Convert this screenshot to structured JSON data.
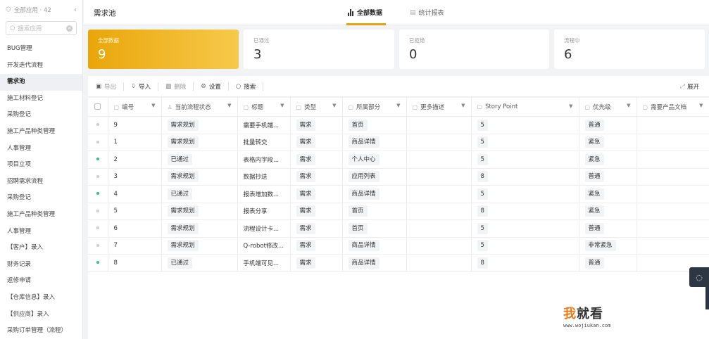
{
  "sidebar": {
    "header_label": "全部应用 · 42",
    "search_placeholder": "搜索应用",
    "items": [
      {
        "label": "BUG管理",
        "active": false
      },
      {
        "label": "开发迭代流程",
        "active": false
      },
      {
        "label": "需求池",
        "active": true
      },
      {
        "label": "施工材料登记",
        "active": false
      },
      {
        "label": "采购登记",
        "active": false
      },
      {
        "label": "施工产品种类管理",
        "active": false
      },
      {
        "label": "人事管理",
        "active": false
      },
      {
        "label": "项目立项",
        "active": false
      },
      {
        "label": "招聘需求流程",
        "active": false
      },
      {
        "label": "采购登记",
        "active": false
      },
      {
        "label": "施工产品种类管理",
        "active": false
      },
      {
        "label": "人事管理",
        "active": false
      },
      {
        "label": "【客户】录入",
        "active": false
      },
      {
        "label": "财务记录",
        "active": false
      },
      {
        "label": "返修申请",
        "active": false
      },
      {
        "label": "【仓库信息】录入",
        "active": false
      },
      {
        "label": "【供应商】录入",
        "active": false
      },
      {
        "label": "采购订单管理（流程）",
        "active": false
      }
    ]
  },
  "header": {
    "title": "需求池",
    "tabs": {
      "all": "全部数据",
      "report": "统计报表"
    }
  },
  "stats": [
    {
      "label": "全部数据",
      "value": "9"
    },
    {
      "label": "已通过",
      "value": "3"
    },
    {
      "label": "已拒绝",
      "value": "0"
    },
    {
      "label": "流程中",
      "value": "6"
    }
  ],
  "toolbar": {
    "export": "导出",
    "import": "导入",
    "delete": "删除",
    "settings": "设置",
    "search": "搜索",
    "expand": "展开"
  },
  "table": {
    "columns": [
      "编号",
      "当前流程状态",
      "标题",
      "类型",
      "所属部分",
      "更多描述",
      "Story Point",
      "优先级",
      "需要产品文档"
    ],
    "rows": [
      {
        "dot": "gray",
        "id": "9",
        "status": "需求规划",
        "title": "需要手机端...",
        "type": "需求",
        "part": "首页",
        "desc": "",
        "sp": "5",
        "priority": "普通"
      },
      {
        "dot": "gray",
        "id": "1",
        "status": "需求规划",
        "title": "批量转交",
        "type": "需求",
        "part": "商品详情",
        "desc": "",
        "sp": "5",
        "priority": "紧急"
      },
      {
        "dot": "green",
        "id": "2",
        "status": "已通过",
        "title": "表格内字段...",
        "type": "需求",
        "part": "个人中心",
        "desc": "",
        "sp": "5",
        "priority": "紧急"
      },
      {
        "dot": "gray",
        "id": "3",
        "status": "需求规划",
        "title": "数据抄送",
        "type": "需求",
        "part": "应用列表",
        "desc": "",
        "sp": "8",
        "priority": "普通"
      },
      {
        "dot": "green",
        "id": "4",
        "status": "已通过",
        "title": "报表增加数...",
        "type": "需求",
        "part": "商品详情",
        "desc": "",
        "sp": "5",
        "priority": "紧急"
      },
      {
        "dot": "gray",
        "id": "5",
        "status": "需求规划",
        "title": "报表分享",
        "type": "需求",
        "part": "首页",
        "desc": "",
        "sp": "8",
        "priority": "紧急"
      },
      {
        "dot": "gray",
        "id": "6",
        "status": "需求规划",
        "title": "流程设计卡...",
        "type": "需求",
        "part": "首页",
        "desc": "",
        "sp": "5",
        "priority": "普通"
      },
      {
        "dot": "gray",
        "id": "7",
        "status": "需求规划",
        "title": "Q-robot修改...",
        "type": "需求",
        "part": "商品详情",
        "desc": "",
        "sp": "5",
        "priority": "非常紧急"
      },
      {
        "dot": "green",
        "id": "8",
        "status": "已通过",
        "title": "手机端可见...",
        "type": "需求",
        "part": "商品详情",
        "desc": "",
        "sp": "8",
        "priority": "普通"
      }
    ]
  },
  "watermark": {
    "title_first": "我",
    "title_rest": "就看",
    "url": "www.wojiukan.com"
  },
  "colors": {
    "accent": "#e6a20f",
    "approved_dot": "#2ec28a",
    "pending_dot": "#cccccc",
    "fab": "#2d3744"
  }
}
